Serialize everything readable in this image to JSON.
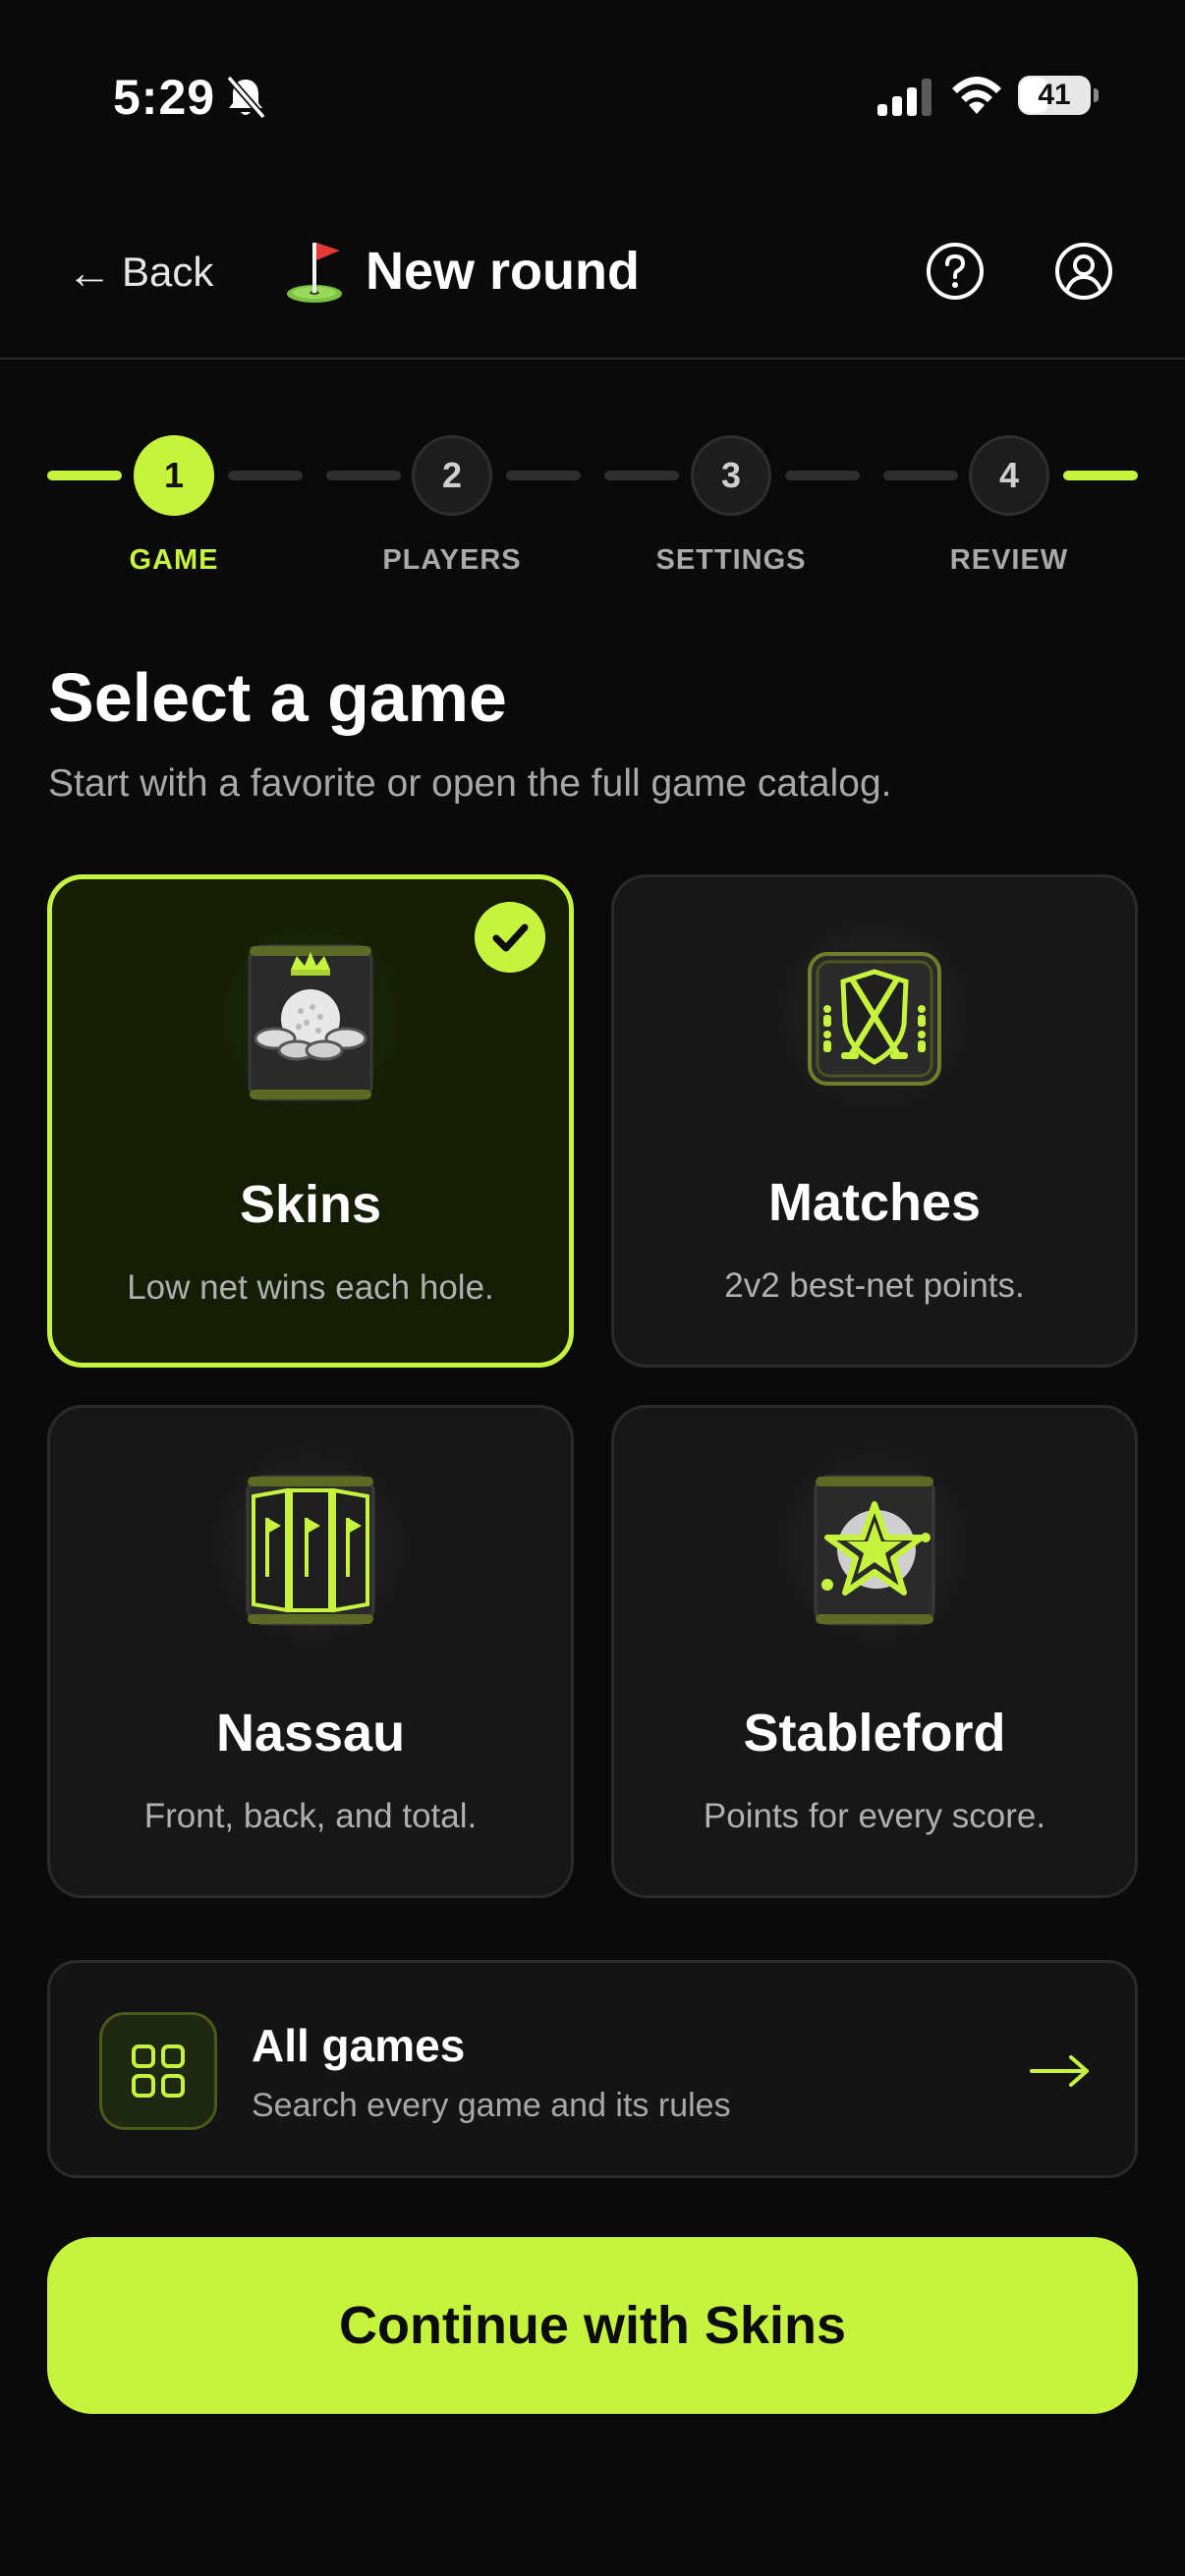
{
  "status_bar": {
    "time": "5:29",
    "battery_text": "41",
    "battery_level": 0.41
  },
  "header": {
    "back_label": "Back",
    "title": "New round"
  },
  "stepper": {
    "current_step": 1,
    "steps": [
      {
        "number": "1",
        "label": "GAME"
      },
      {
        "number": "2",
        "label": "PLAYERS"
      },
      {
        "number": "3",
        "label": "SETTINGS"
      },
      {
        "number": "4",
        "label": "REVIEW"
      }
    ]
  },
  "main": {
    "title": "Select a game",
    "subtitle": "Start with a favorite or open the full game catalog."
  },
  "games": [
    {
      "title": "Skins",
      "desc": "Low net wins each hole.",
      "icon": "skins-icon",
      "selected": true
    },
    {
      "title": "Matches",
      "desc": "2v2 best-net points.",
      "icon": "matches-icon",
      "selected": false
    },
    {
      "title": "Nassau",
      "desc": "Front, back, and total.",
      "icon": "nassau-icon",
      "selected": false
    },
    {
      "title": "Stableford",
      "desc": "Points for every score.",
      "icon": "stableford-icon",
      "selected": false
    }
  ],
  "all_games": {
    "title": "All games",
    "subtitle": "Search every game and its rules"
  },
  "continue_label": "Continue with Skins",
  "colors": {
    "accent": "#c6f33d",
    "background": "#0a0a0a",
    "card": "#171717",
    "selected_card": "#151d05"
  }
}
